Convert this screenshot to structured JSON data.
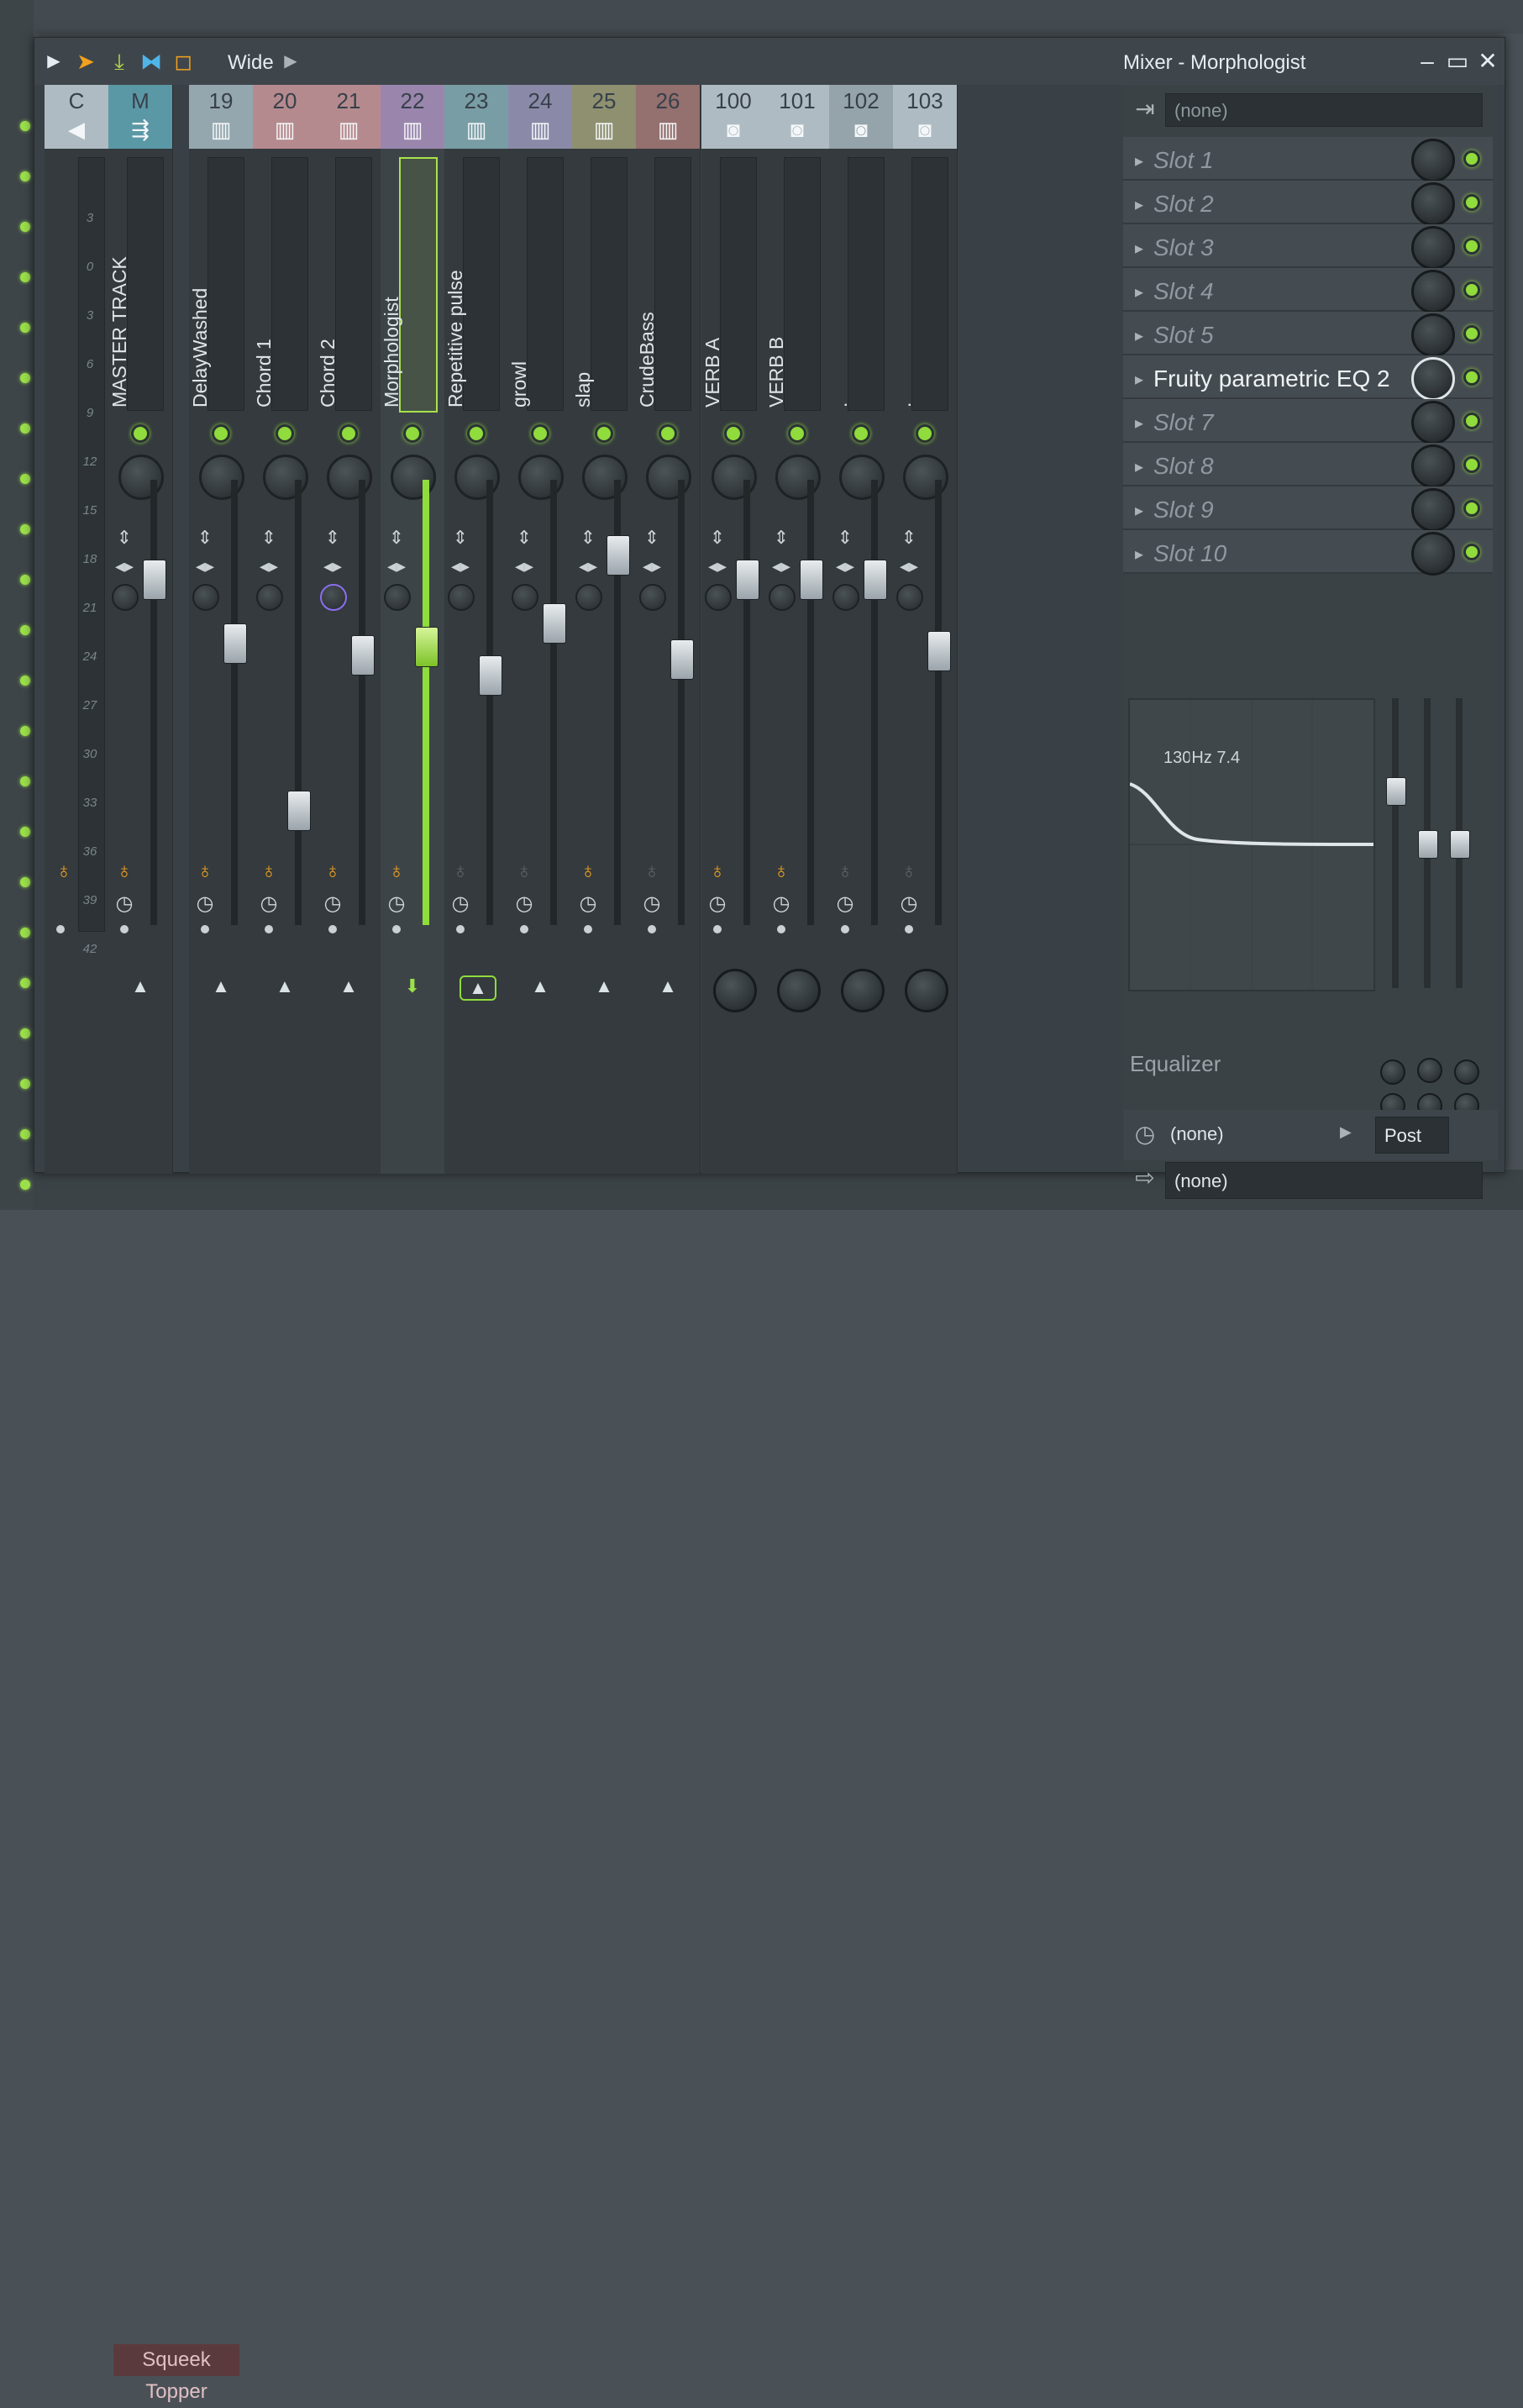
{
  "window": {
    "title": "Mixer - Morphologist",
    "view_mode": "Wide",
    "minimize_icon": "minimize-icon",
    "maximize_icon": "maximize-icon",
    "close_icon": "close-icon"
  },
  "background": {
    "pattern_name": "Squeek Topper"
  },
  "meter_scale": [
    "3",
    "0",
    "3",
    "6",
    "9",
    "12",
    "15",
    "18",
    "21",
    "24",
    "27",
    "30",
    "33",
    "36",
    "39",
    "42"
  ],
  "channels": [
    {
      "id": "C",
      "name": "",
      "icon": "speaker-icon",
      "color": "#aebbc2",
      "armed": true
    },
    {
      "id": "M",
      "name": "MASTER TRACK",
      "icon": "master-routing-icon",
      "color": "#5b98a6",
      "level": 0.8,
      "armed": true
    },
    {
      "id": "19",
      "name": "DelayWashed",
      "icon": "piano-icon",
      "color": "#95a7ae",
      "level": 0.64,
      "armed": true
    },
    {
      "id": "20",
      "name": "Chord 1",
      "icon": "piano-icon",
      "color": "#b58a8e",
      "level": 0.22,
      "armed": true
    },
    {
      "id": "21",
      "name": "Chord 2",
      "icon": "piano-icon",
      "color": "#b58a8e",
      "level": 0.61,
      "armed": true
    },
    {
      "id": "22",
      "name": "Morphologist",
      "icon": "piano-icon",
      "color": "#9a86ad",
      "level": 0.63,
      "armed": true
    },
    {
      "id": "23",
      "name": "Repetitive pulse",
      "icon": "piano-icon",
      "color": "#799da4",
      "level": 0.56,
      "armed": false
    },
    {
      "id": "24",
      "name": "growl",
      "icon": "piano-icon",
      "color": "#8a8aa8",
      "level": 0.69,
      "armed": false
    },
    {
      "id": "25",
      "name": "slap",
      "icon": "piano-icon",
      "color": "#8e9070",
      "level": 0.86,
      "armed": true
    },
    {
      "id": "26",
      "name": "CrudeBass",
      "icon": "piano-icon",
      "color": "#94706f",
      "level": 0.6,
      "armed": false
    },
    {
      "id": "100",
      "name": "VERB A",
      "icon": "bus-icon",
      "color": "#aebbc2",
      "level": 0.8,
      "armed": true
    },
    {
      "id": "101",
      "name": "VERB B",
      "icon": "bus-icon",
      "color": "#aebbc2",
      "level": 0.8,
      "armed": true
    },
    {
      "id": "102",
      "name": ".",
      "icon": "bus-icon",
      "color": "#95a3aa",
      "level": 0.8,
      "armed": false
    },
    {
      "id": "103",
      "name": ".",
      "icon": "bus-icon",
      "color": "#aebbc2",
      "level": 0.62,
      "armed": false
    }
  ],
  "fx": {
    "input": "(none)",
    "slots": [
      {
        "label": "Slot 1",
        "active": false
      },
      {
        "label": "Slot 2",
        "active": false
      },
      {
        "label": "Slot 3",
        "active": false
      },
      {
        "label": "Slot 4",
        "active": false
      },
      {
        "label": "Slot 5",
        "active": false
      },
      {
        "label": "Fruity parametric EQ 2",
        "active": true
      },
      {
        "label": "Slot 7",
        "active": false
      },
      {
        "label": "Slot 8",
        "active": false
      },
      {
        "label": "Slot 9",
        "active": false
      },
      {
        "label": "Slot 10",
        "active": false
      }
    ],
    "eq_readout": "130Hz 7.4",
    "eq_name": "Equalizer",
    "eq_band_levels": [
      0.7,
      0.5,
      0.5
    ],
    "output_clock": "(none)",
    "post_label": "Post",
    "output": "(none)"
  }
}
